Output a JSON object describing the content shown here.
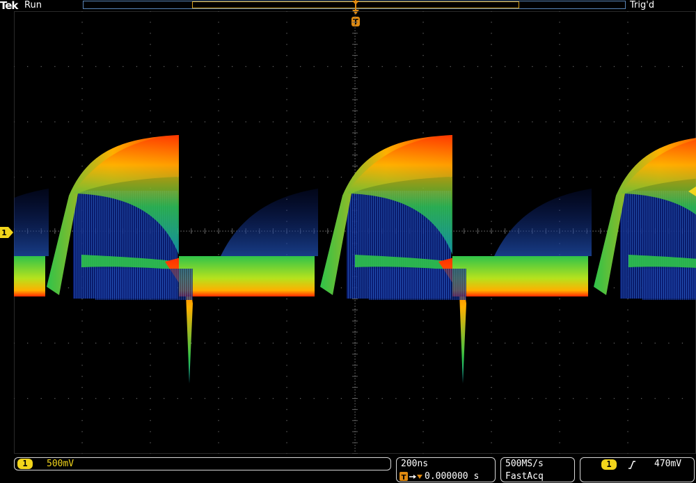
{
  "header": {
    "brand": "Tek",
    "run_state": "Run",
    "trigger_status": "Trig'd",
    "trigger_marker": "T"
  },
  "channel": {
    "number": "1",
    "scale": "500mV",
    "color": "#f2d51b"
  },
  "timebase": {
    "per_div": "200ns",
    "delay": "0.000000 s"
  },
  "acquisition": {
    "sample_rate": "500MS/s",
    "mode": "FastAcq"
  },
  "trigger": {
    "source": "1",
    "slope": "rising",
    "level": "470mV"
  },
  "display": {
    "palette": [
      "#0a1e78",
      "#1f4fb0",
      "#13a0a8",
      "#2fc34a",
      "#b6e21d",
      "#ffb000",
      "#ff2a00"
    ],
    "graticule_color": "#5e5e5e"
  },
  "icons": [
    "trigger-position-icon",
    "ground-level-icon",
    "trigger-level-icon",
    "rising-edge-icon"
  ]
}
